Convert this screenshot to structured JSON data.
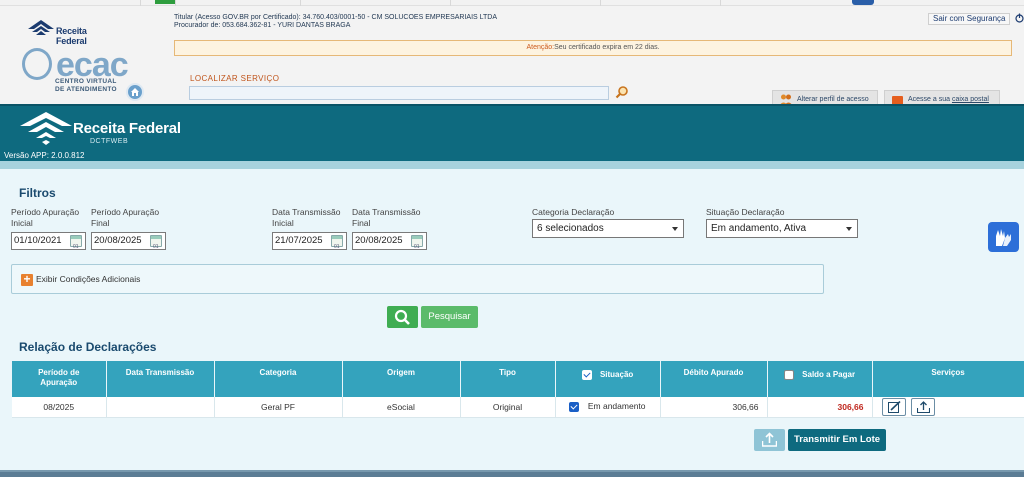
{
  "ecac": {
    "rf_logo_text": "Receita Federal",
    "logo_text": "ecac",
    "logo_sub": [
      "CENTRO VIRTUAL",
      "DE ATENDIMENTO"
    ],
    "user_line1": "Titular (Acesso GOV.BR por Certificado): 34.760.403/0001-50 - CM SOLUCOES EMPRESARIAIS LTDA",
    "user_line2": "Procurador de: 053.684.362-81 - YURI DANTAS BRAGA",
    "logout_label": "Sair com Segurança",
    "alert_label": "Atenção:",
    "alert_text": "Seu certificado expira em 22 dias.",
    "search_label": "LOCALIZAR SERVIÇO",
    "search_value": "",
    "alterar_label": "Alterar perfil de acesso",
    "acesse_label": "Acesse a sua ",
    "acesse_link": "caixa postal"
  },
  "app": {
    "title": "Receita Federal",
    "subtitle": "DCTFWEB",
    "version": "Versão APP: 2.0.0.812"
  },
  "filters": {
    "title": "Filtros",
    "periodo_inicial_label": [
      "Período Apuração",
      "Inicial"
    ],
    "periodo_inicial_value": "01/10/2021",
    "periodo_final_label": [
      "Período Apuração",
      "Final"
    ],
    "periodo_final_value": "20/08/2025",
    "transmissao_inicial_label": [
      "Data Transmissão",
      "Inicial"
    ],
    "transmissao_inicial_value": "21/07/2025",
    "transmissao_final_label": [
      "Data Transmissão",
      "Final"
    ],
    "transmissao_final_value": "20/08/2025",
    "categoria_label": "Categoria Declaração",
    "categoria_value": "6 selecionados",
    "situacao_label": "Situação Declaração",
    "situacao_value": "Em andamento, Ativa",
    "calendar_text": "01",
    "conditions_label": "Exibir Condições Adicionais",
    "search_button": "Pesquisar"
  },
  "declarations": {
    "title": "Relação de Declarações",
    "headers": {
      "periodo": [
        "Período de",
        "Apuração"
      ],
      "data_transmissao": "Data Transmissão",
      "categoria": "Categoria",
      "origem": "Origem",
      "tipo": "Tipo",
      "situacao": "Situação",
      "debito": "Débito Apurado",
      "saldo": "Saldo a Pagar",
      "servicos": "Serviços"
    },
    "rows": [
      {
        "periodo": "08/2025",
        "data_transmissao": "",
        "categoria": "Geral PF",
        "origem": "eSocial",
        "tipo": "Original",
        "situacao": "Em andamento",
        "debito": "306,66",
        "saldo": "306,66"
      }
    ],
    "transmit_button": "Transmitir Em Lote"
  },
  "colors": {
    "header_teal": "#0e6a7f",
    "table_header": "#34a3bd",
    "content_bg": "#eaf6fa",
    "green_button": "#3fad52",
    "saldo_red": "#c0281f",
    "accent_orange": "#e8812f"
  }
}
